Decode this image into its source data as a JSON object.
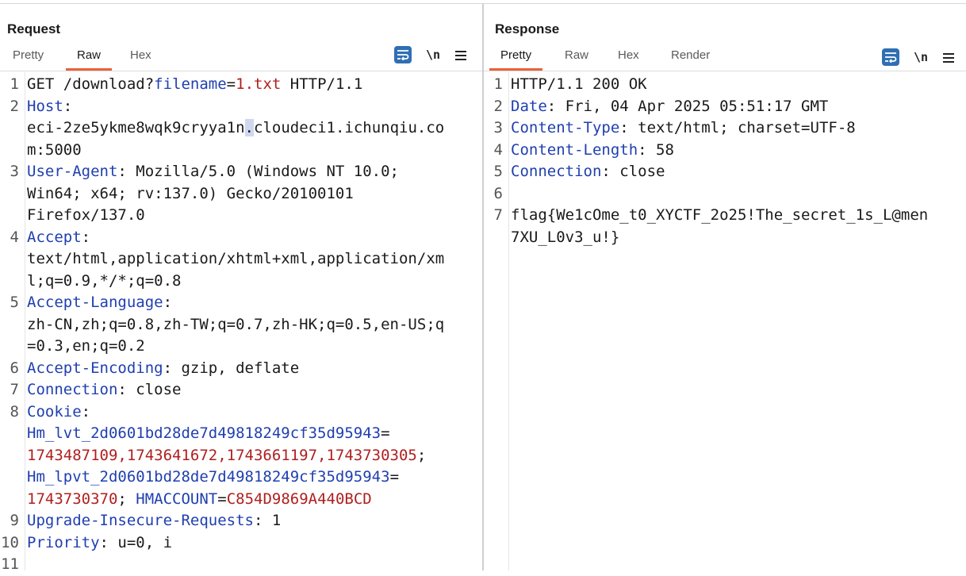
{
  "view_toggle": {
    "options": [
      "side-by-side",
      "horizontal-split",
      "single"
    ],
    "active": "side-by-side"
  },
  "request": {
    "title": "Request",
    "tabs": [
      {
        "label": "Pretty",
        "active": false
      },
      {
        "label": "Raw",
        "active": true
      },
      {
        "label": "Hex",
        "active": false
      }
    ],
    "toolbar": {
      "newline_label": "\\n"
    },
    "lines": [
      {
        "num": "1",
        "parts": [
          [
            "t",
            "GET /download?"
          ],
          [
            "k",
            "filename"
          ],
          [
            "t",
            "="
          ],
          [
            "v",
            "1.txt"
          ],
          [
            "t",
            " HTTP/1.1"
          ]
        ]
      },
      {
        "num": "2",
        "parts": [
          [
            "k",
            "Host"
          ],
          [
            "t",
            ":"
          ]
        ]
      },
      {
        "num": "",
        "parts": [
          [
            "t",
            "eci-2ze5ykme8wqk9cryya1n"
          ],
          [
            "c",
            "."
          ],
          [
            "t",
            "cloudeci1.ichunqiu.co"
          ]
        ]
      },
      {
        "num": "",
        "parts": [
          [
            "t",
            "m:5000"
          ]
        ]
      },
      {
        "num": "3",
        "parts": [
          [
            "k",
            "User-Agent"
          ],
          [
            "t",
            ": Mozilla/5.0 (Windows NT 10.0;"
          ]
        ]
      },
      {
        "num": "",
        "parts": [
          [
            "t",
            "Win64; x64; rv:137.0) Gecko/20100101"
          ]
        ]
      },
      {
        "num": "",
        "parts": [
          [
            "t",
            "Firefox/137.0"
          ]
        ]
      },
      {
        "num": "4",
        "parts": [
          [
            "k",
            "Accept"
          ],
          [
            "t",
            ":"
          ]
        ]
      },
      {
        "num": "",
        "parts": [
          [
            "t",
            "text/html,application/xhtml+xml,application/xm"
          ]
        ]
      },
      {
        "num": "",
        "parts": [
          [
            "t",
            "l;q=0.9,*/*;q=0.8"
          ]
        ]
      },
      {
        "num": "5",
        "parts": [
          [
            "k",
            "Accept-Language"
          ],
          [
            "t",
            ":"
          ]
        ]
      },
      {
        "num": "",
        "parts": [
          [
            "t",
            "zh-CN,zh;q=0.8,zh-TW;q=0.7,zh-HK;q=0.5,en-US;q"
          ]
        ]
      },
      {
        "num": "",
        "parts": [
          [
            "t",
            "=0.3,en;q=0.2"
          ]
        ]
      },
      {
        "num": "6",
        "parts": [
          [
            "k",
            "Accept-Encoding"
          ],
          [
            "t",
            ": gzip, deflate"
          ]
        ]
      },
      {
        "num": "7",
        "parts": [
          [
            "k",
            "Connection"
          ],
          [
            "t",
            ": close"
          ]
        ]
      },
      {
        "num": "8",
        "parts": [
          [
            "k",
            "Cookie"
          ],
          [
            "t",
            ":"
          ]
        ]
      },
      {
        "num": "",
        "parts": [
          [
            "k",
            "Hm_lvt_2d0601bd28de7d49818249cf35d95943"
          ],
          [
            "t",
            "="
          ]
        ]
      },
      {
        "num": "",
        "parts": [
          [
            "v",
            "1743487109,1743641672,1743661197,1743730305"
          ],
          [
            "t",
            ";"
          ]
        ]
      },
      {
        "num": "",
        "parts": [
          [
            "k",
            "Hm_lpvt_2d0601bd28de7d49818249cf35d95943"
          ],
          [
            "t",
            "="
          ]
        ]
      },
      {
        "num": "",
        "parts": [
          [
            "v",
            "1743730370"
          ],
          [
            "t",
            "; "
          ],
          [
            "k",
            "HMACCOUNT"
          ],
          [
            "t",
            "="
          ],
          [
            "v",
            "C854D9869A440BCD"
          ]
        ]
      },
      {
        "num": "9",
        "parts": [
          [
            "k",
            "Upgrade-Insecure-Requests"
          ],
          [
            "t",
            ": 1"
          ]
        ]
      },
      {
        "num": "10",
        "parts": [
          [
            "k",
            "Priority"
          ],
          [
            "t",
            ": u=0, i"
          ]
        ]
      },
      {
        "num": "11",
        "parts": []
      }
    ]
  },
  "response": {
    "title": "Response",
    "tabs": [
      {
        "label": "Pretty",
        "active": true
      },
      {
        "label": "Raw",
        "active": false
      },
      {
        "label": "Hex",
        "active": false
      },
      {
        "label": "Render",
        "active": false
      }
    ],
    "toolbar": {
      "newline_label": "\\n"
    },
    "lines": [
      {
        "num": "1",
        "parts": [
          [
            "t",
            "HTTP/1.1 200 OK"
          ]
        ]
      },
      {
        "num": "2",
        "parts": [
          [
            "k",
            "Date"
          ],
          [
            "t",
            ": Fri, 04 Apr 2025 05:51:17 GMT"
          ]
        ]
      },
      {
        "num": "3",
        "parts": [
          [
            "k",
            "Content-Type"
          ],
          [
            "t",
            ": text/html; charset=UTF-8"
          ]
        ]
      },
      {
        "num": "4",
        "parts": [
          [
            "k",
            "Content-Length"
          ],
          [
            "t",
            ": 58"
          ]
        ]
      },
      {
        "num": "5",
        "parts": [
          [
            "k",
            "Connection"
          ],
          [
            "t",
            ": close"
          ]
        ]
      },
      {
        "num": "6",
        "parts": []
      },
      {
        "num": "7",
        "parts": [
          [
            "t",
            "flag{We1cOme_t0_XYCTF_2o25!The_secret_1s_L@men"
          ]
        ],
        "highlight": true
      },
      {
        "num": "",
        "parts": [
          [
            "t",
            "7XU_L0v3_u!}"
          ]
        ],
        "highlight": true
      }
    ]
  }
}
